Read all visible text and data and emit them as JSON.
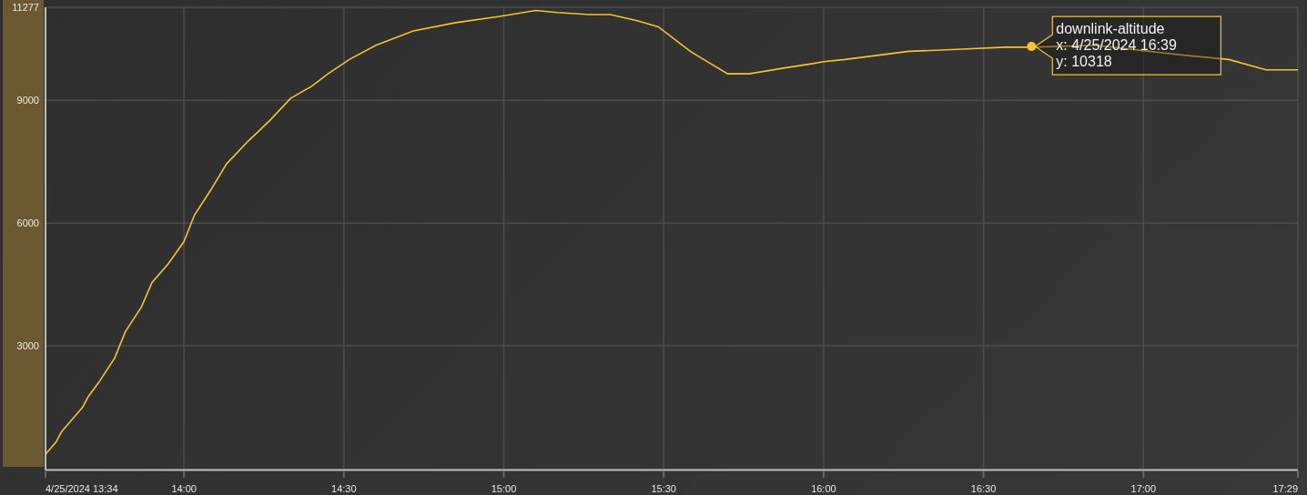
{
  "chart_data": {
    "type": "line",
    "grid": true,
    "xlim": [
      13.567,
      17.483
    ],
    "ylim": [
      0,
      11277
    ],
    "xticks": [
      {
        "value": 13.567,
        "label": "4/25/2024 13:34"
      },
      {
        "value": 14,
        "label": "14:00"
      },
      {
        "value": 14.5,
        "label": "14:30"
      },
      {
        "value": 15,
        "label": "15:00"
      },
      {
        "value": 15.5,
        "label": "15:30"
      },
      {
        "value": 16,
        "label": "16:00"
      },
      {
        "value": 16.5,
        "label": "16:30"
      },
      {
        "value": 17,
        "label": "17:00"
      },
      {
        "value": 17.483,
        "label": "17:29"
      }
    ],
    "yticks": [
      3000,
      6000,
      9000,
      11277
    ],
    "x": [
      13.567,
      13.6,
      13.617,
      13.65,
      13.683,
      13.7,
      13.733,
      13.783,
      13.817,
      13.867,
      13.9,
      13.95,
      14,
      14.033,
      14.083,
      14.133,
      14.2,
      14.267,
      14.333,
      14.4,
      14.45,
      14.517,
      14.6,
      14.717,
      14.85,
      14.983,
      15.1,
      15.167,
      15.267,
      15.333,
      15.417,
      15.483,
      15.583,
      15.7,
      15.767,
      15.883,
      15.967,
      16,
      16.067,
      16.167,
      16.267,
      16.417,
      16.567,
      16.65,
      16.85,
      17.017,
      17.133,
      17.267,
      17.383,
      17.483
    ],
    "series": [
      {
        "name": "downlink-altitude",
        "color": "#f5c32c",
        "values": [
          350,
          650,
          900,
          1200,
          1500,
          1750,
          2100,
          2700,
          3350,
          3950,
          4550,
          5000,
          5550,
          6200,
          6800,
          7450,
          8000,
          8500,
          9050,
          9350,
          9650,
          10000,
          10350,
          10700,
          10900,
          11050,
          11200,
          11150,
          11100,
          11100,
          10950,
          10800,
          10200,
          9650,
          9650,
          9800,
          9900,
          9950,
          10000,
          10100,
          10200,
          10250,
          10300,
          10300,
          10350,
          10200,
          10100,
          10000,
          9750,
          9750
        ]
      }
    ],
    "annotations": [
      {
        "x": 16.65,
        "y": 10318,
        "text": "x: 4/25/2024 16:39\ny: 10318"
      }
    ]
  }
}
